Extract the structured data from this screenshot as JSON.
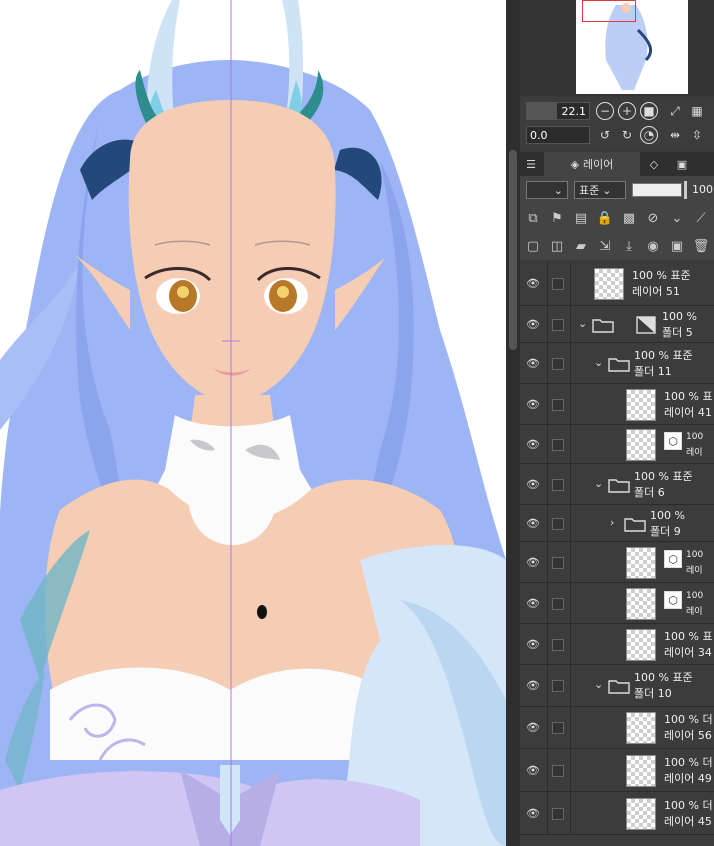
{
  "navigator": {
    "zoom_value": "22.1",
    "rotation_value": "0.0"
  },
  "tabs": [
    {
      "label": "레이어",
      "active": true
    }
  ],
  "layer_props": {
    "blend_mode": "표준",
    "opacity": "100"
  },
  "layers": [
    {
      "opacity": "100 %",
      "mode": "표준",
      "name": "레이어 51",
      "type": "raster",
      "indent": 0
    },
    {
      "opacity": "100 %",
      "mode": "",
      "name": "폴더 5",
      "type": "folder",
      "indent": 0,
      "expanded": true
    },
    {
      "opacity": "100 %",
      "mode": "표준",
      "name": "폴더 11",
      "type": "folder",
      "indent": 1,
      "expanded": true
    },
    {
      "opacity": "100 %",
      "mode": "표",
      "name": "레이어 41",
      "type": "raster",
      "indent": 2
    },
    {
      "opacity": "100",
      "mode": "",
      "name": "레이",
      "type": "3d",
      "indent": 2
    },
    {
      "opacity": "100 %",
      "mode": "표준",
      "name": "폴더 6",
      "type": "folder",
      "indent": 1,
      "expanded": true
    },
    {
      "opacity": "100 %",
      "mode": "",
      "name": "폴더 9",
      "type": "folder",
      "indent": 2,
      "expanded": false
    },
    {
      "opacity": "100",
      "mode": "",
      "name": "레이",
      "type": "3d",
      "indent": 2
    },
    {
      "opacity": "100",
      "mode": "",
      "name": "레이",
      "type": "3d",
      "indent": 2
    },
    {
      "opacity": "100 %",
      "mode": "표",
      "name": "레이어 34",
      "type": "raster",
      "indent": 2
    },
    {
      "opacity": "100 %",
      "mode": "표준",
      "name": "폴더 10",
      "type": "folder",
      "indent": 1,
      "expanded": true
    },
    {
      "opacity": "100 %",
      "mode": "더",
      "name": "레이어 56",
      "type": "raster",
      "indent": 2
    },
    {
      "opacity": "100 %",
      "mode": "더",
      "name": "레이어 49",
      "type": "raster",
      "indent": 2
    },
    {
      "opacity": "100 %",
      "mode": "더",
      "name": "레이어 45",
      "type": "raster",
      "indent": 2
    }
  ],
  "colors": {
    "hair": "#9db4f5",
    "skin": "#f5cdb4",
    "horn_dark": "#24487a",
    "panel_bg": "#3c3c3c",
    "guide_line": "#b07ae6"
  }
}
